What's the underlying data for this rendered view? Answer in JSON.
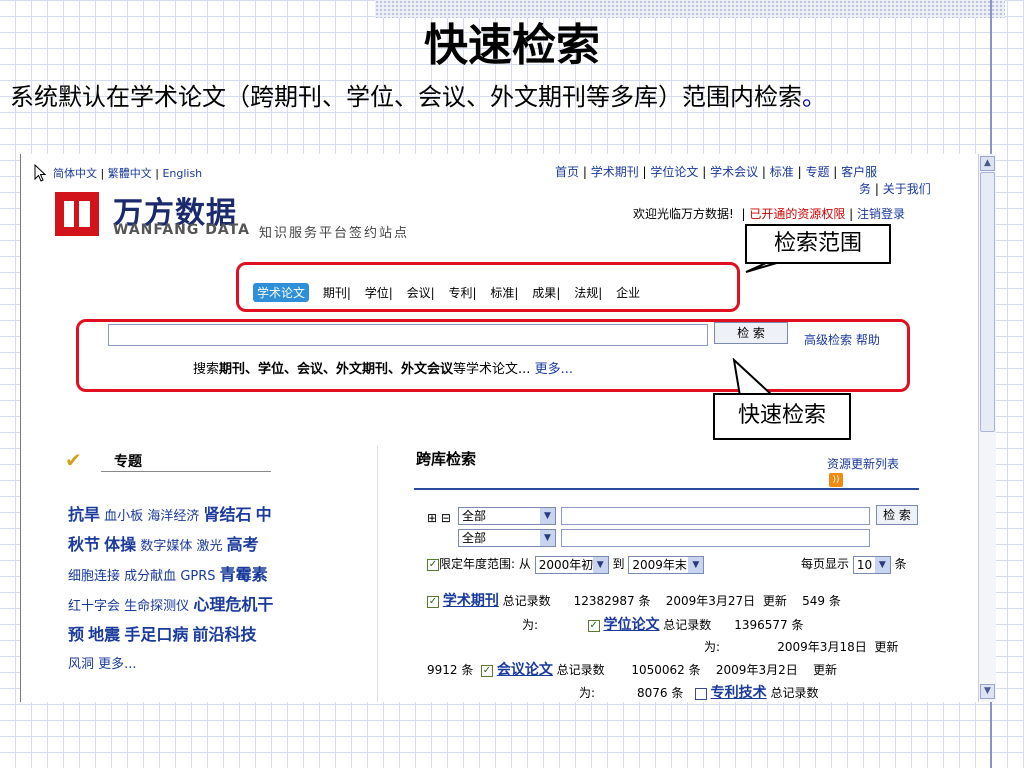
{
  "slide": {
    "title": "快速检索",
    "subtitle": "系统默认在学术论文（跨期刊、学位、会议、外文期刊等多库）范围内检索",
    "subtitle_end": "。"
  },
  "browser": {
    "lang": {
      "jian": "简体中文",
      "fan": "繁體中文",
      "en": "English",
      "sep": "|"
    },
    "logo": {
      "cn": "万方数据",
      "en": "WANFANG DATA",
      "slogan": "知识服务平台签约站点"
    },
    "topnav": [
      "首页",
      "学术期刊",
      "学位论文",
      "学术会议",
      "标准",
      "专题",
      "客户服",
      "务",
      "关于我们"
    ],
    "welcome": "欢迎光临万方数据!",
    "access": "已开通的资源权限",
    "logout": "注销登录",
    "tabs": [
      "学术论文",
      "期刊",
      "学位",
      "会议",
      "专利",
      "标准",
      "成果",
      "法规",
      "企业"
    ],
    "search_btn": "检 索",
    "adv": "高级检索",
    "help": "帮助",
    "hint_pre": "搜索",
    "hint_bold": "期刊、学位、会议、外文期刊、外文会议",
    "hint_post": "等学术论文...",
    "more": "更多...",
    "topics_title": "专题",
    "topics": [
      "抗旱",
      "血小板",
      "海洋经济",
      "肾结石",
      "中",
      "秋节",
      "体操",
      "数字媒体",
      "激光",
      "高考",
      "细胞连接",
      "成分献血",
      "GPRS",
      "青霉素",
      "红十字会",
      "生命探测仪",
      "心理危机干",
      "预",
      "地震",
      "手足口病",
      "前沿科技",
      "风洞",
      "更多..."
    ],
    "cross": {
      "title": "跨库检索",
      "update": "资源更新列表",
      "sel1": "全部",
      "sel2": "全部",
      "btn": "检 索",
      "limit": "限定年度范围:",
      "from": "从",
      "year_from": "2000年初",
      "to": "到",
      "year_to": "2009年末",
      "perpage": "每页显示",
      "perpage_val": "10",
      "unit": "条",
      "r1_name": "学术期刊",
      "r1_a": "总记录数",
      "r1_count": "12382987 条",
      "r1_date": "2009年3月27日",
      "r1_upd": "更新",
      "r1_num": "549 条",
      "r1_wei": "为:",
      "r2_name": "学位论文",
      "r2_a": "总记录数",
      "r2_count": "1396577 条",
      "r2_wei": "为:",
      "r2_date": "2009年3月18日",
      "r2_upd": "更新",
      "r2_num": "9912 条",
      "r3_name": "会议论文",
      "r3_a": "总记录数",
      "r3_count": "1050062 条",
      "r3_date": "2009年3月2日",
      "r3_upd": "更新",
      "r3_wei": "为:",
      "r3_num": "8076 条",
      "r4_name": "专利技术",
      "r4_a": "总记录数"
    }
  },
  "callouts": {
    "scope": "检索范围",
    "quick": "快速检索"
  }
}
